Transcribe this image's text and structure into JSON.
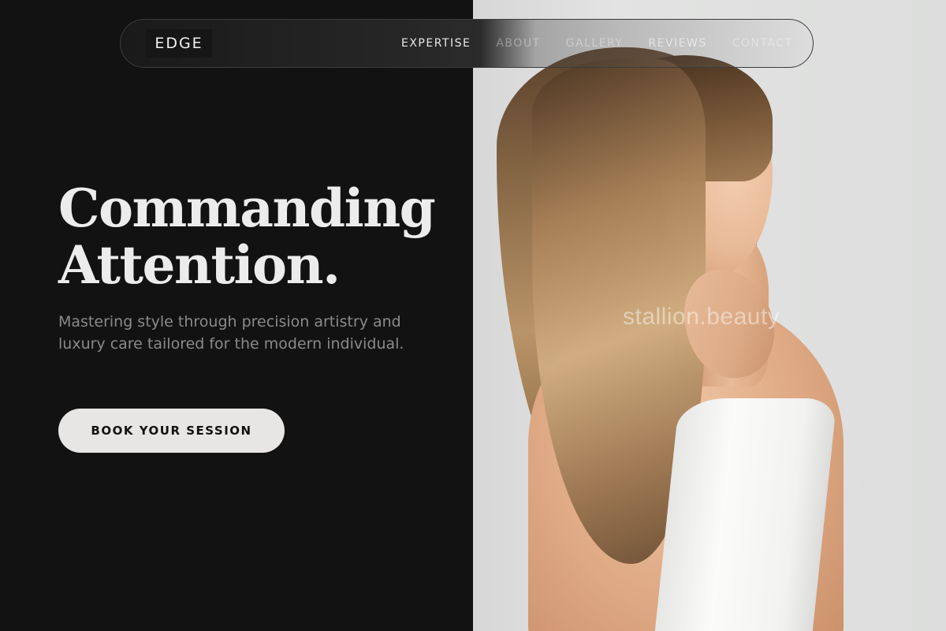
{
  "brand": {
    "logo_text": "EDGE"
  },
  "nav": {
    "items": [
      {
        "label": "EXPERTISE"
      },
      {
        "label": "ABOUT"
      },
      {
        "label": "GALLERY"
      },
      {
        "label": "REVIEWS"
      },
      {
        "label": "CONTACT"
      }
    ]
  },
  "hero": {
    "title_line1": "Commanding",
    "title_line2": "Attention.",
    "subtitle": "Mastering style through precision artistry and luxury care tailored for the modern individual.",
    "cta_label": "BOOK YOUR SESSION"
  },
  "image": {
    "watermark": "stallion.beauty"
  },
  "colors": {
    "left_background": "#121212",
    "right_background": "#dcdddc",
    "title_text": "#ececec",
    "subtitle_text": "#8a8a8a",
    "cta_background": "#e7e6e4",
    "cta_text": "#111111"
  }
}
